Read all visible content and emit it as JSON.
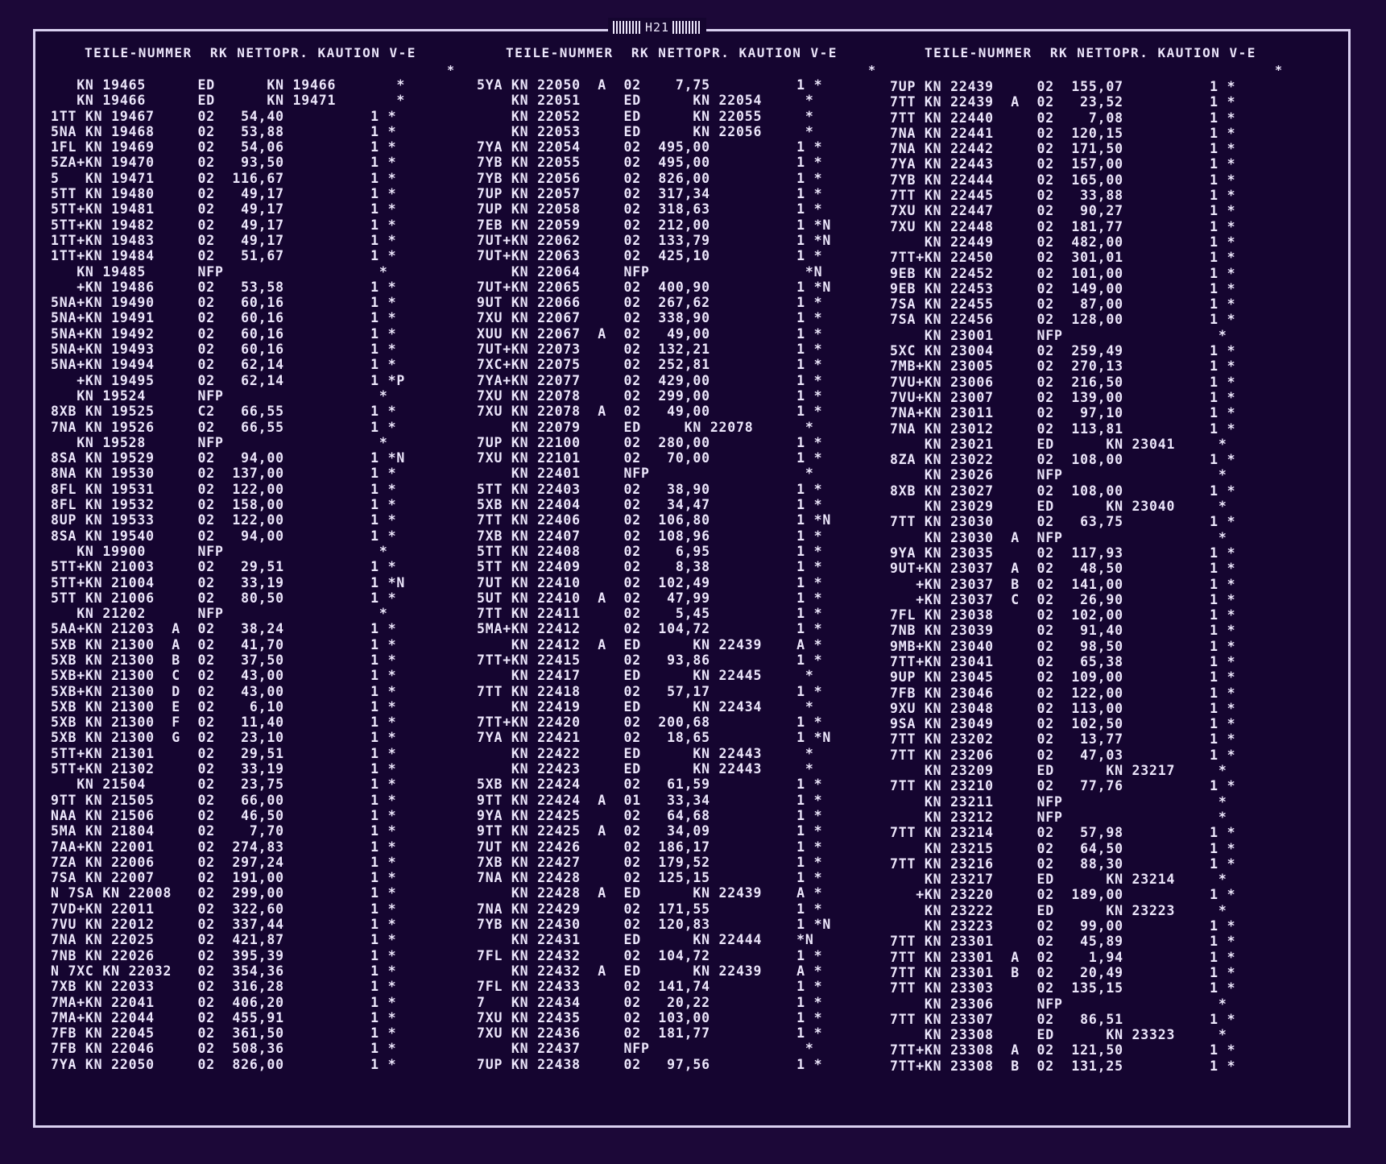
{
  "page_id": "H21",
  "columns": [
    {
      "header": "TEILE-NUMMER  RK NETTOPR. KAUTION V-E",
      "star": "*",
      "rows": [
        "   KN 19465      ED      KN 19466       *",
        "   KN 19466      ED      KN 19471       *",
        "1TT KN 19467     02   54,40          1 *",
        "5NA KN 19468     02   53,88          1 *",
        "1FL KN 19469     02   54,06          1 *",
        "5ZA+KN 19470     02   93,50          1 *",
        "5   KN 19471     02  116,67          1 *",
        "5TT KN 19480     02   49,17          1 *",
        "5TT+KN 19481     02   49,17          1 *",
        "5TT+KN 19482     02   49,17          1 *",
        "1TT+KN 19483     02   49,17          1 *",
        "1TT+KN 19484     02   51,67          1 *",
        "   KN 19485      NFP                  *",
        "   +KN 19486     02   53,58          1 *",
        "5NA+KN 19490     02   60,16          1 *",
        "5NA+KN 19491     02   60,16          1 *",
        "5NA+KN 19492     02   60,16          1 *",
        "5NA+KN 19493     02   60,16          1 *",
        "5NA+KN 19494     02   62,14          1 *",
        "   +KN 19495     02   62,14          1 *P",
        "   KN 19524      NFP                  *",
        "8XB KN 19525     C2   66,55          1 *",
        "7NA KN 19526     02   66,55          1 *",
        "   KN 19528      NFP                  *",
        "8SA KN 19529     02   94,00          1 *N",
        "8NA KN 19530     02  137,00          1 *",
        "8FL KN 19531     02  122,00          1 *",
        "8FL KN 19532     02  158,00          1 *",
        "8UP KN 19533     02  122,00          1 *",
        "8SA KN 19540     02   94,00          1 *",
        "   KN 19900      NFP                  *",
        "5TT+KN 21003     02   29,51          1 *",
        "5TT+KN 21004     02   33,19          1 *N",
        "5TT KN 21006     02   80,50          1 *",
        "   KN 21202      NFP                  *",
        "5AA+KN 21203  A  02   38,24          1 *",
        "5XB KN 21300  A  02   41,70          1 *",
        "5XB KN 21300  B  02   37,50          1 *",
        "5XB+KN 21300  C  02   43,00          1 *",
        "5XB+KN 21300  D  02   43,00          1 *",
        "5XB KN 21300  E  02    6,10          1 *",
        "5XB KN 21300  F  02   11,40          1 *",
        "5XB KN 21300  G  02   23,10          1 *",
        "5TT+KN 21301     02   29,51          1 *",
        "5TT+KN 21302     02   33,19          1 *",
        "   KN 21504      02   23,75          1 *",
        "9TT KN 21505     02   66,00          1 *",
        "NAA KN 21506     02   46,50          1 *",
        "5MA KN 21804     02    7,70          1 *",
        "7AA+KN 22001     02  274,83          1 *",
        "7ZA KN 22006     02  297,24          1 *",
        "7SA KN 22007     02  191,00          1 *",
        "N 7SA KN 22008   02  299,00          1 *",
        "7VD+KN 22011     02  322,60          1 *",
        "7VU KN 22012     02  337,44          1 *",
        "7NA KN 22025     02  421,87          1 *",
        "7NB KN 22026     02  395,39          1 *",
        "N 7XC KN 22032   02  354,36          1 *",
        "7XB KN 22033     02  316,28          1 *",
        "7MA+KN 22041     02  406,20          1 *",
        "7MA+KN 22044     02  455,91          1 *",
        "7FB KN 22045     02  361,50          1 *",
        "7FB KN 22046     02  508,36          1 *",
        "7YA KN 22050     02  826,00          1 *"
      ]
    },
    {
      "header": "TEILE-NUMMER  RK NETTOPR. KAUTION V-E",
      "star": "*",
      "rows": [
        "5YA KN 22050  A  02    7,75          1 *",
        "    KN 22051     ED      KN 22054     *",
        "    KN 22052     ED      KN 22055     *",
        "    KN 22053     ED      KN 22056     *",
        "7YA KN 22054     02  495,00          1 *",
        "7YB KN 22055     02  495,00          1 *",
        "7YB KN 22056     02  826,00          1 *",
        "7UP KN 22057     02  317,34          1 *",
        "7UP KN 22058     02  318,63          1 *",
        "7EB KN 22059     02  212,00          1 *N",
        "7UT+KN 22062     02  133,79          1 *N",
        "7UT+KN 22063     02  425,10          1 *",
        "    KN 22064     NFP                  *N",
        "7UT+KN 22065     02  400,90          1 *N",
        "9UT KN 22066     02  267,62          1 *",
        "7XU KN 22067     02  338,90          1 *",
        "XUU KN 22067  A  02   49,00          1 *",
        "7UT+KN 22073     02  132,21          1 *",
        "7XC+KN 22075     02  252,81          1 *",
        "7YA+KN 22077     02  429,00          1 *",
        "7XU KN 22078     02  299,00          1 *",
        "7XU KN 22078  A  02   49,00          1 *",
        "    KN 22079     ED     KN 22078      *",
        "7UP KN 22100     02  280,00          1 *",
        "7XU KN 22101     02   70,00          1 *",
        "    KN 22401     NFP                  *",
        "5TT KN 22403     02   38,90          1 *",
        "5XB KN 22404     02   34,47          1 *",
        "7TT KN 22406     02  106,80          1 *N",
        "7XB KN 22407     02  108,96          1 *",
        "5TT KN 22408     02    6,95          1 *",
        "5TT KN 22409     02    8,38          1 *",
        "7UT KN 22410     02  102,49          1 *",
        "5UT KN 22410  A  02   47,99          1 *",
        "7TT KN 22411     02    5,45          1 *",
        "5MA+KN 22412     02  104,72          1 *",
        "    KN 22412  A  ED      KN 22439    A *",
        "7TT+KN 22415     02   93,86          1 *",
        "    KN 22417     ED      KN 22445     *",
        "7TT KN 22418     02   57,17          1 *",
        "    KN 22419     ED      KN 22434     *",
        "7TT+KN 22420     02  200,68          1 *",
        "7YA KN 22421     02   18,65          1 *N",
        "    KN 22422     ED      KN 22443     *",
        "    KN 22423     ED      KN 22443     *",
        "5XB KN 22424     02   61,59          1 *",
        "9TT KN 22424  A  01   33,34          1 *",
        "9YA KN 22425     02   64,68          1 *",
        "9TT KN 22425  A  02   34,09          1 *",
        "7UT KN 22426     02  186,17          1 *",
        "7XB KN 22427     02  179,52          1 *",
        "7NA KN 22428     02  125,15          1 *",
        "    KN 22428  A  ED      KN 22439    A *",
        "7NA KN 22429     02  171,55          1 *",
        "7YB KN 22430     02  120,83          1 *N",
        "    KN 22431     ED      KN 22444    *N",
        "7FL KN 22432     02  104,72          1 *",
        "    KN 22432  A  ED      KN 22439    A *",
        "7FL KN 22433     02  141,74          1 *",
        "7   KN 22434     02   20,22          1 *",
        "7XU KN 22435     02  103,00          1 *",
        "7XU KN 22436     02  181,77          1 *",
        "    KN 22437     NFP                  *",
        "7UP KN 22438     02   97,56          1 *"
      ]
    },
    {
      "header": "TEILE-NUMMER  RK NETTOPR. KAUTION V-E",
      "star": "*",
      "rows": [
        "7UP KN 22439     02  155,07          1 *",
        "7TT KN 22439  A  02   23,52          1 *",
        "7TT KN 22440     02    7,08          1 *",
        "7NA KN 22441     02  120,15          1 *",
        "7NA KN 22442     02  171,50          1 *",
        "7YA KN 22443     02  157,00          1 *",
        "7YB KN 22444     02  165,00          1 *",
        "7TT KN 22445     02   33,88          1 *",
        "7XU KN 22447     02   90,27          1 *",
        "7XU KN 22448     02  181,77          1 *",
        "    KN 22449     02  482,00          1 *",
        "7TT+KN 22450     02  301,01          1 *",
        "9EB KN 22452     02  101,00          1 *",
        "9EB KN 22453     02  149,00          1 *",
        "7SA KN 22455     02   87,00          1 *",
        "7SA KN 22456     02  128,00          1 *",
        "    KN 23001     NFP                  *",
        "5XC KN 23004     02  259,49          1 *",
        "7MB+KN 23005     02  270,13          1 *",
        "7VU+KN 23006     02  216,50          1 *",
        "7VU+KN 23007     02  139,00          1 *",
        "7NA+KN 23011     02   97,10          1 *",
        "7NA KN 23012     02  113,81          1 *",
        "    KN 23021     ED      KN 23041     *",
        "8ZA KN 23022     02  108,00          1 *",
        "    KN 23026     NFP                  *",
        "8XB KN 23027     02  108,00          1 *",
        "    KN 23029     ED      KN 23040     *",
        "7TT KN 23030     02   63,75          1 *",
        "    KN 23030  A  NFP                  *",
        "9YA KN 23035     02  117,93          1 *",
        "9UT+KN 23037  A  02   48,50          1 *",
        "   +KN 23037  B  02  141,00          1 *",
        "   +KN 23037  C  02   26,90          1 *",
        "7FL KN 23038     02  102,00          1 *",
        "7NB KN 23039     02   91,40          1 *",
        "9MB+KN 23040     02   98,50          1 *",
        "7TT+KN 23041     02   65,38          1 *",
        "9UP KN 23045     02  109,00          1 *",
        "7FB KN 23046     02  122,00          1 *",
        "9XU KN 23048     02  113,00          1 *",
        "9SA KN 23049     02  102,50          1 *",
        "7TT KN 23202     02   13,77          1 *",
        "7TT KN 23206     02   47,03          1 *",
        "    KN 23209     ED      KN 23217     *",
        "7TT KN 23210     02   77,76          1 *",
        "    KN 23211     NFP                  *",
        "    KN 23212     NFP                  *",
        "7TT KN 23214     02   57,98          1 *",
        "    KN 23215     02   64,50          1 *",
        "7TT KN 23216     02   88,30          1 *",
        "    KN 23217     ED      KN 23214     *",
        "   +KN 23220     02  189,00          1 *",
        "    KN 23222     ED      KN 23223     *",
        "    KN 23223     02   99,00          1 *",
        "7TT KN 23301     02   45,89          1 *",
        "7TT KN 23301  A  02    1,94          1 *",
        "7TT KN 23301  B  02   20,49          1 *",
        "7TT KN 23303     02  135,15          1 *",
        "    KN 23306     NFP                  *",
        "7TT KN 23307     02   86,51          1 *",
        "    KN 23308     ED      KN 23323     *",
        "7TT+KN 23308  A  02  121,50          1 *",
        "7TT+KN 23308  B  02  131,25          1 *"
      ]
    }
  ]
}
